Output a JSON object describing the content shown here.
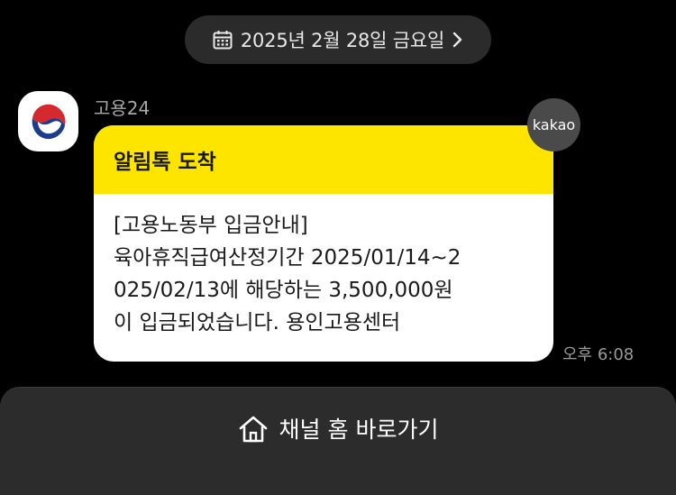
{
  "header": {
    "date_label": "2025년 2월 28일 금요일",
    "calendar_icon": "calendar-icon",
    "chevron_icon": "chevron-right-icon"
  },
  "message": {
    "sender_name": "고용24",
    "avatar_icon": "korea-government-emblem-icon",
    "badge_label": "kakao",
    "header_title": "알림톡 도착",
    "body_lines": [
      "[고용노동부 입금안내]",
      "육아휴직급여산정기간 2025/01/14~2",
      "025/02/13에 해당하는 3,500,000원",
      "이 입금되었습니다. 용인고용센터"
    ],
    "time": "오후 6:08"
  },
  "footer": {
    "home_icon": "home-icon",
    "channel_home_label": "채널 홈 바로가기"
  },
  "colors": {
    "background": "#000000",
    "bubble_header": "#fee500",
    "bubble_body": "#ffffff",
    "pill": "#2b2b2b",
    "footer": "#2c2c2c"
  }
}
